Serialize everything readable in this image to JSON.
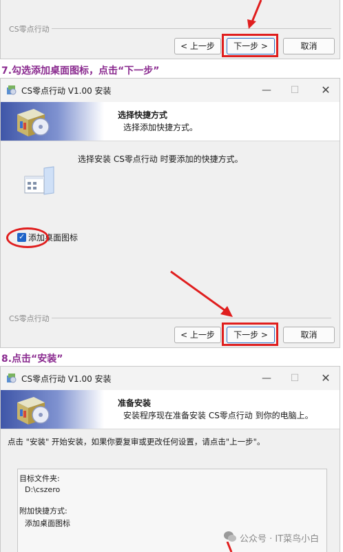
{
  "window1": {
    "group_label": "CS零点行动",
    "back_button": "< 上一步",
    "next_button": "下一步 >",
    "cancel_button": "取消"
  },
  "step7_heading": "7.勾选添加桌面图标，点击“下一步”",
  "window2": {
    "title": "CS零点行动 V1.00 安装",
    "header_title": "选择快捷方式",
    "header_subtitle": "选择添加快捷方式。",
    "description": "选择安装 CS零点行动 时要添加的快捷方式。",
    "checkbox_label": "添加桌面图标",
    "checkbox_checked": true,
    "group_label": "CS零点行动",
    "back_button": "< 上一步",
    "next_button": "下一步 >",
    "cancel_button": "取消"
  },
  "step8_heading": "8.点击“安装”",
  "window3": {
    "title": "CS零点行动 V1.00 安装",
    "header_title": "准备安装",
    "header_subtitle": "安装程序现在准备安装 CS零点行动 到你的电脑上。",
    "description": "点击 \"安装\" 开始安装，如果你要复审或更改任何设置，请点击\"上一步\"。",
    "target_folder_label": "目标文件夹:",
    "target_folder_value": "D:\\cszero",
    "shortcuts_label": "附加快捷方式:",
    "shortcuts_value": "添加桌面图标"
  },
  "watermark": "公众号 · IT菜鸟小白",
  "colors": {
    "accent": "#2b6cc4",
    "annotation": "#e01e1e",
    "heading": "#8a2a8f"
  }
}
